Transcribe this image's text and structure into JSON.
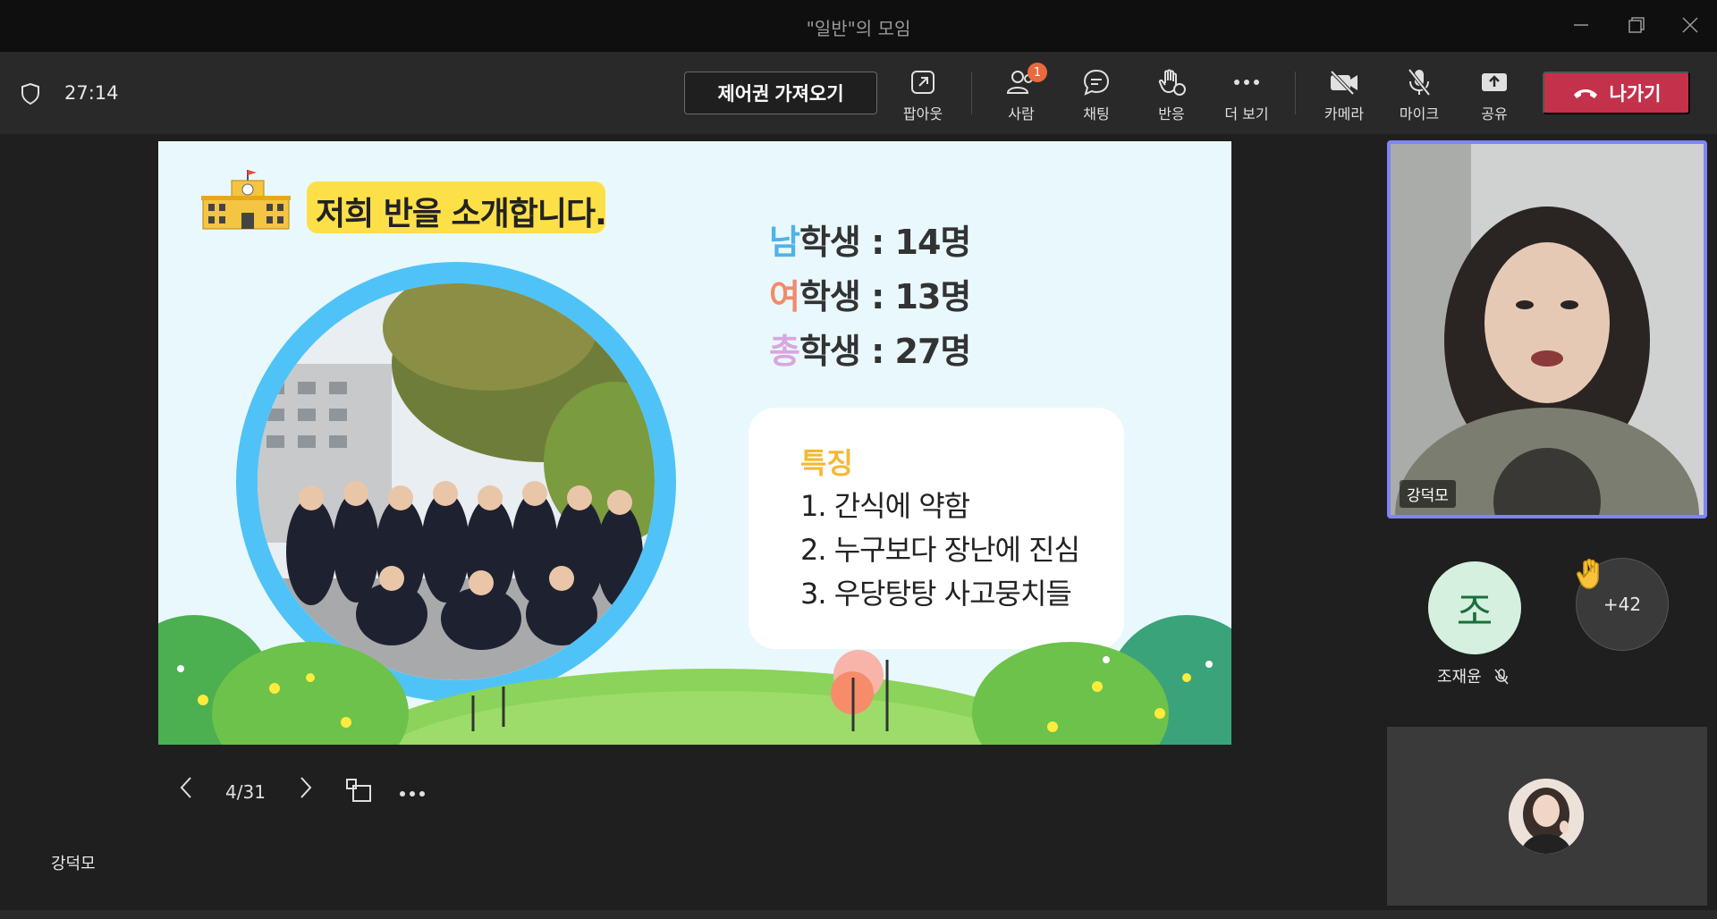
{
  "window": {
    "title": "\"일반\"의 모임"
  },
  "toolbar": {
    "timer": "27:14",
    "take_control_label": "제어권 가져오기",
    "popout_label": "팝아웃",
    "people_label": "사람",
    "people_badge": "1",
    "chat_label": "채팅",
    "reactions_label": "반응",
    "more_label": "더 보기",
    "camera_label": "카메라",
    "mic_label": "마이크",
    "share_label": "공유",
    "leave_label": "나가기"
  },
  "slide": {
    "title": "저희 반을 소개합니다.",
    "stats": [
      {
        "accent": "남",
        "rest": "학생 : 14명",
        "color": "#4fb3e8"
      },
      {
        "accent": "여",
        "rest": "학생 : 13명",
        "color": "#f28b6b"
      },
      {
        "accent": "총",
        "rest": "학생 : 27명",
        "color": "#d8a6e0"
      }
    ],
    "feature_title": "특징",
    "features": [
      "1. 간식에 약함",
      "2. 누구보다 장난에 진심",
      "3. 우당탕탕 사고뭉치들"
    ]
  },
  "slide_nav": {
    "page": "4/31"
  },
  "presenter": {
    "name": "강덕모"
  },
  "participants": {
    "video_name": "강덕모",
    "avatar_initial": "조",
    "avatar_name": "조재윤",
    "more_count": "+42"
  },
  "colors": {
    "accent": "#7f85f5",
    "leave": "#c4314b",
    "badge": "#e96a3f"
  }
}
